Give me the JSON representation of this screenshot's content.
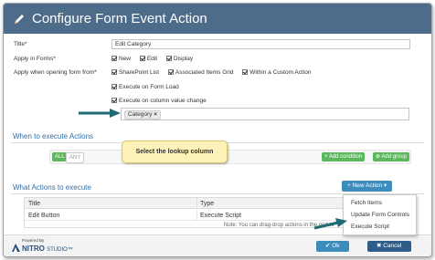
{
  "dialog": {
    "title": "Configure Form Event Action"
  },
  "form": {
    "title_label": "Title*",
    "title_value": "Edit Category",
    "apply_forms_label": "Apply in Forms*",
    "apply_forms_options": [
      "New",
      "Edit",
      "Display"
    ],
    "apply_opening_label": "Apply when opening form from*",
    "apply_opening_options": [
      "SharePoint List",
      "Associated Items Grid",
      "Within a Custom Action"
    ],
    "exec_form_load": "Execute on Form Load",
    "exec_column_change": "Execute on column value change",
    "column_tag": "Category"
  },
  "when": {
    "title": "When to execute Actions",
    "all_label": "ALL",
    "any_label": "ANY",
    "add_condition": "+ Add condition",
    "add_group": "⊕ Add group"
  },
  "callout": {
    "text": "Select the lookup column"
  },
  "what": {
    "title": "What Actions to execute",
    "new_action": "+ New Action ▾",
    "columns": [
      "Title",
      "Type"
    ],
    "rows": [
      {
        "title": "Edit Button",
        "type": "Execute Script"
      }
    ],
    "note": "Note: You can drag-drop actions in the grid to"
  },
  "menu": {
    "items": [
      "Fetch Items",
      "Update Form Controls",
      "Execute Script"
    ]
  },
  "footer": {
    "powered": "Powered By",
    "brand": "NITRO",
    "brand2": "STUDIO™",
    "ok": "✔ Ok",
    "cancel": "✖ Cancel"
  },
  "colors": {
    "header": "#4c6c89",
    "green": "#5cb85c",
    "blue": "#3c8dbc",
    "link": "#2f6fa8",
    "arrow": "#1f6b73"
  }
}
